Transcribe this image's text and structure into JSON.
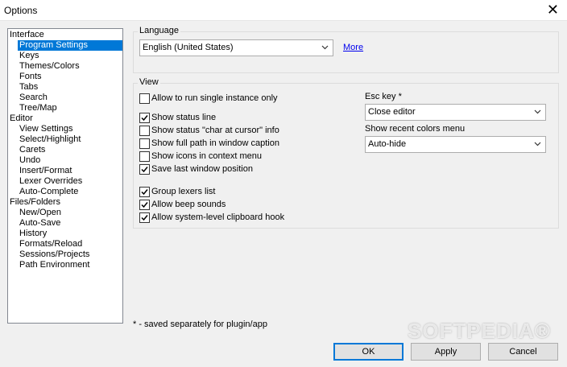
{
  "window": {
    "title": "Options"
  },
  "tree": {
    "items": [
      {
        "label": "Interface",
        "level": 0
      },
      {
        "label": "Program Settings",
        "level": 1,
        "selected": true
      },
      {
        "label": "Keys",
        "level": 1
      },
      {
        "label": "Themes/Colors",
        "level": 1
      },
      {
        "label": "Fonts",
        "level": 1
      },
      {
        "label": "Tabs",
        "level": 1
      },
      {
        "label": "Search",
        "level": 1
      },
      {
        "label": "Tree/Map",
        "level": 1
      },
      {
        "label": "Editor",
        "level": 0
      },
      {
        "label": "View Settings",
        "level": 1
      },
      {
        "label": "Select/Highlight",
        "level": 1
      },
      {
        "label": "Carets",
        "level": 1
      },
      {
        "label": "Undo",
        "level": 1
      },
      {
        "label": "Insert/Format",
        "level": 1
      },
      {
        "label": "Lexer Overrides",
        "level": 1
      },
      {
        "label": "Auto-Complete",
        "level": 1
      },
      {
        "label": "Files/Folders",
        "level": 0
      },
      {
        "label": "New/Open",
        "level": 1
      },
      {
        "label": "Auto-Save",
        "level": 1
      },
      {
        "label": "History",
        "level": 1
      },
      {
        "label": "Formats/Reload",
        "level": 1
      },
      {
        "label": "Sessions/Projects",
        "level": 1
      },
      {
        "label": "Path Environment",
        "level": 1
      }
    ]
  },
  "language": {
    "group_title": "Language",
    "selected": "English (United States)",
    "more_link": "More"
  },
  "view": {
    "group_title": "View",
    "checkboxes": [
      {
        "label": "Allow to run single instance only",
        "checked": false
      },
      {
        "label": "Show status line",
        "checked": true
      },
      {
        "label": "Show status \"char at cursor\" info",
        "checked": false
      },
      {
        "label": "Show full path in window caption",
        "checked": false
      },
      {
        "label": "Show icons in context menu",
        "checked": false
      },
      {
        "label": "Save last window position",
        "checked": true
      },
      {
        "label": "Group lexers list",
        "checked": true
      },
      {
        "label": "Allow beep sounds",
        "checked": true
      },
      {
        "label": "Allow system-level clipboard hook",
        "checked": true
      }
    ],
    "esc_key_label": "Esc key *",
    "esc_key_value": "Close editor",
    "recent_colors_label": "Show recent colors menu",
    "recent_colors_value": "Auto-hide"
  },
  "footnote": "* - saved separately for plugin/app",
  "buttons": {
    "ok": "OK",
    "apply": "Apply",
    "cancel": "Cancel"
  },
  "watermark": "SOFTPEDIA®",
  "colors": {
    "selection": "#0078d7",
    "link": "#0000ee"
  }
}
